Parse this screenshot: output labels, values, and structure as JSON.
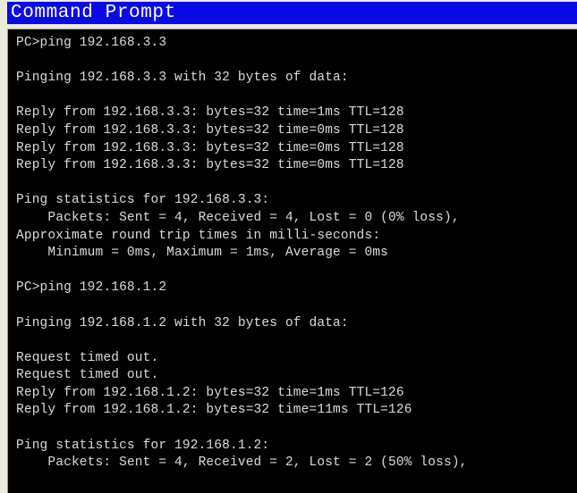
{
  "window": {
    "title": "Command Prompt",
    "title_bar_color": "#0a0ae8",
    "title_text_color": "#ffffff",
    "frame_color": "#ece9dd",
    "console_bg_color": "#000000",
    "console_text_color": "#d6d6d6"
  },
  "console": {
    "prompt_symbol": "PC>",
    "lines": [
      "PC>ping 192.168.3.3",
      "",
      "Pinging 192.168.3.3 with 32 bytes of data:",
      "",
      "Reply from 192.168.3.3: bytes=32 time=1ms TTL=128",
      "Reply from 192.168.3.3: bytes=32 time=0ms TTL=128",
      "Reply from 192.168.3.3: bytes=32 time=0ms TTL=128",
      "Reply from 192.168.3.3: bytes=32 time=0ms TTL=128",
      "",
      "Ping statistics for 192.168.3.3:",
      "    Packets: Sent = 4, Received = 4, Lost = 0 (0% loss),",
      "Approximate round trip times in milli-seconds:",
      "    Minimum = 0ms, Maximum = 1ms, Average = 0ms",
      "",
      "PC>ping 192.168.1.2",
      "",
      "Pinging 192.168.1.2 with 32 bytes of data:",
      "",
      "Request timed out.",
      "Request timed out.",
      "Reply from 192.168.1.2: bytes=32 time=1ms TTL=126",
      "Reply from 192.168.1.2: bytes=32 time=11ms TTL=126",
      "",
      "Ping statistics for 192.168.1.2:",
      "    Packets: Sent = 4, Received = 2, Lost = 2 (50% loss),"
    ],
    "sessions": [
      {
        "command": "ping 192.168.3.3",
        "target": "192.168.3.3",
        "payload_bytes": 32,
        "replies": [
          {
            "from": "192.168.3.3",
            "bytes": 32,
            "time": "1ms",
            "ttl": 128
          },
          {
            "from": "192.168.3.3",
            "bytes": 32,
            "time": "0ms",
            "ttl": 128
          },
          {
            "from": "192.168.3.3",
            "bytes": 32,
            "time": "0ms",
            "ttl": 128
          },
          {
            "from": "192.168.3.3",
            "bytes": 32,
            "time": "0ms",
            "ttl": 128
          }
        ],
        "statistics": {
          "sent": 4,
          "received": 4,
          "lost": 0,
          "loss_percent": "0%"
        },
        "round_trip": {
          "minimum": "0ms",
          "maximum": "1ms",
          "average": "0ms"
        }
      },
      {
        "command": "ping 192.168.1.2",
        "target": "192.168.1.2",
        "payload_bytes": 32,
        "replies": [
          {
            "status": "Request timed out."
          },
          {
            "status": "Request timed out."
          },
          {
            "from": "192.168.1.2",
            "bytes": 32,
            "time": "1ms",
            "ttl": 126
          },
          {
            "from": "192.168.1.2",
            "bytes": 32,
            "time": "11ms",
            "ttl": 126
          }
        ],
        "statistics": {
          "sent": 4,
          "received": 2,
          "lost": 2,
          "loss_percent": "50%"
        }
      }
    ]
  }
}
